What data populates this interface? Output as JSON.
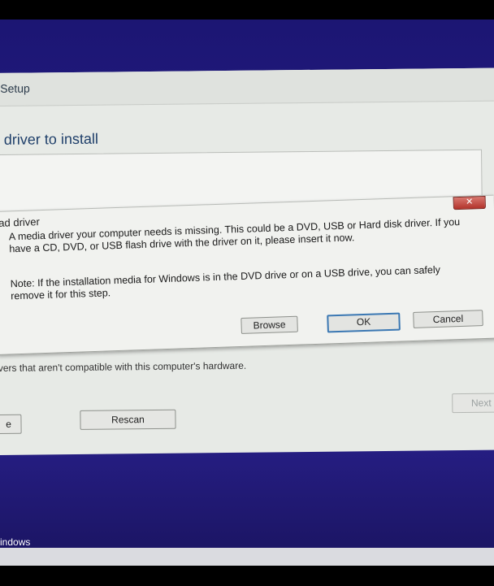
{
  "window": {
    "title": "Setup"
  },
  "page": {
    "heading": "driver to install",
    "warning": "vers that aren't compatible with this computer's hardware."
  },
  "dialog": {
    "title": "ad driver",
    "close": "✕",
    "message": "A media driver your computer needs is missing. This could be a DVD, USB or Hard disk driver. If you have a CD, DVD, or USB flash drive with the driver on it, please insert it now.",
    "note": "Note: If the installation media for Windows is in the DVD drive or on a USB drive, you can safely remove it for this step.",
    "buttons": {
      "browse": "Browse",
      "ok": "OK",
      "cancel": "Cancel"
    }
  },
  "buttons": {
    "left": "e",
    "rescan": "Rescan",
    "next": "Next"
  },
  "taskbar": {
    "label": "indows"
  }
}
